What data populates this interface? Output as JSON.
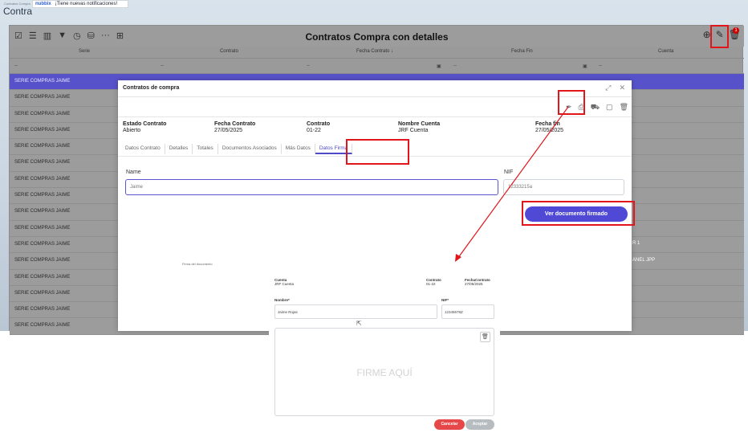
{
  "app": {
    "brand_small": "Contratos Compra",
    "brand_title": "Contra",
    "notification": {
      "brand": "nubbix",
      "text": "¡Tiene nuevas notificaciones!"
    }
  },
  "grid": {
    "title": "Contratos Compra con detalles",
    "badge": "1",
    "columns": [
      "Serie",
      "Contrato",
      "Fecha Contrato ↓",
      "Fecha Fin",
      "Cuenta"
    ],
    "filter_placeholder": "--",
    "rows": [
      "SERIE COMPRAS JAIME",
      "SERIE COMPRAS JAIME",
      "SERIE COMPRAS JAIME",
      "SERIE COMPRAS JAIME",
      "SERIE COMPRAS JAIME",
      "SERIE COMPRAS JAIME",
      "SERIE COMPRAS JAIME",
      "SERIE COMPRAS JAIME",
      "SERIE COMPRAS JAIME",
      "SERIE COMPRAS JAIME",
      "SERIE COMPRAS JAIME",
      "SERIE COMPRAS JAIME",
      "SERIE COMPRAS JAIME",
      "SERIE COMPRAS JAIME",
      "SERIE COMPRAS JAIME",
      "SERIE COMPRAS JAIME"
    ],
    "side_values": [
      "R 1",
      "ANEL JPP"
    ]
  },
  "modal": {
    "title": "Contratos de compra",
    "info": [
      {
        "label": "Estado Contrato",
        "value": "Abierto"
      },
      {
        "label": "Fecha Contrato",
        "value": "27/05/2025"
      },
      {
        "label": "Contrato",
        "value": "01-22"
      },
      {
        "label": "Nombre Cuenta",
        "value": "JRF Cuenta"
      },
      {
        "label": "Fecha fin",
        "value": "27/05/2025"
      }
    ],
    "tabs": [
      "Datos Contrato",
      "Detalles",
      "Totales",
      "Documentos Asociados",
      "Más Datos",
      "Datos Firma"
    ],
    "name_label": "Name",
    "name_value": "Jaime",
    "nif_label": "NIF",
    "nif_value": "12333215a",
    "view_button": "Ver documento firmado",
    "firma_label": "Firma del documento"
  },
  "pad": {
    "cuenta_label": "Cuenta",
    "cuenta_value": "JRF Cuenta",
    "contrato_label": "Contrato",
    "contrato_value": "01-22",
    "fecha_label": "FechaContrato",
    "fecha_value": "27/05/2025",
    "nombre_label": "Nombre*",
    "nombre_value": "Jaime Rojas",
    "nif_label": "NIF*",
    "nif_value": "12345678Z",
    "hint": "FIRME AQUÍ",
    "cancel": "Cancelar",
    "accept": "Aceptar"
  },
  "colors": {
    "accent": "#5049d6",
    "highlight": "#e0161b",
    "cancel": "#e6484a"
  }
}
